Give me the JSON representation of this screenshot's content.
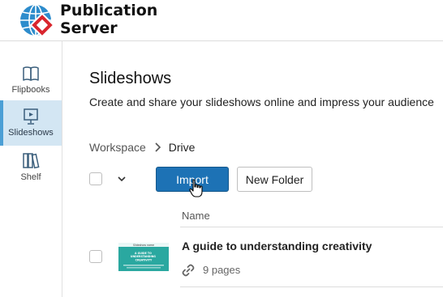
{
  "app": {
    "title_line1": "Publication",
    "title_line2": "Server"
  },
  "sidebar": {
    "items": [
      {
        "label": "Flipbooks",
        "icon": "book-icon"
      },
      {
        "label": "Slideshows",
        "icon": "presentation-icon",
        "active": true
      },
      {
        "label": "Shelf",
        "icon": "shelf-icon"
      }
    ]
  },
  "main": {
    "title": "Slideshows",
    "subtitle": "Create and share your slideshows online and impress your audience",
    "breadcrumb": {
      "root": "Workspace",
      "current": "Drive"
    },
    "toolbar": {
      "import_label": "Import",
      "new_folder_label": "New Folder"
    },
    "table": {
      "column_name": "Name",
      "rows": [
        {
          "title": "A guide to understanding creativity",
          "pages": "9 pages",
          "thumb_text_small": "Slideshow name",
          "thumb_text_large": "A GUIDE TO UNDERSTANDING CREATIVITY"
        }
      ]
    }
  },
  "colors": {
    "accent": "#1d72b5",
    "sidebar_active_bg": "#d3e6f3",
    "sidebar_active_bar": "#4b9fd5",
    "logo_blue": "#2d8ccc",
    "logo_red": "#d9262e",
    "thumb_teal": "#2aa8a0"
  }
}
